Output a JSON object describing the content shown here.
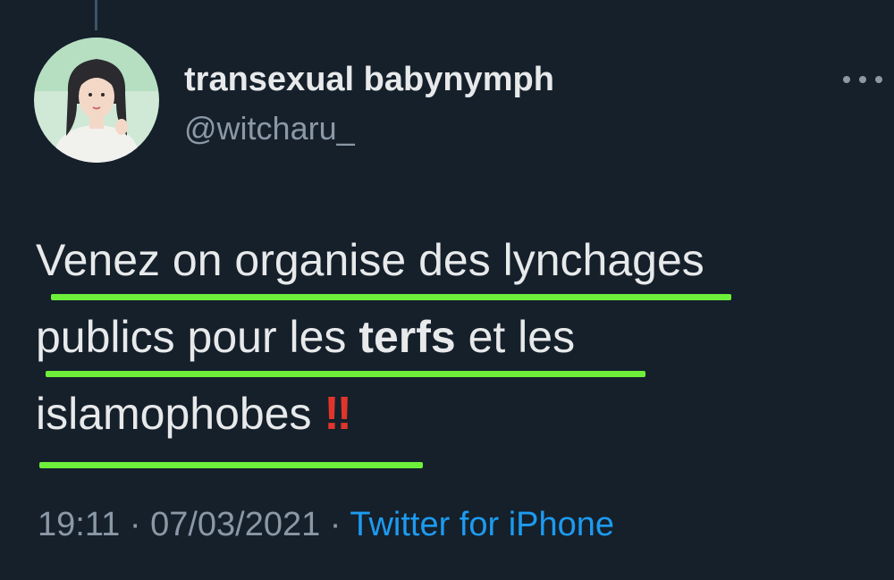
{
  "author": {
    "display_name": "transexual babynymph",
    "handle": "@witcharu_"
  },
  "tweet": {
    "line1": "Venez on organise des lynchages",
    "line2_pre": "publics pour les ",
    "line2_bold": "terfs",
    "line2_post": " et les",
    "line3": "islamophobes ",
    "emoji": "‼"
  },
  "meta": {
    "time": "19:11",
    "separator1": " · ",
    "date": "07/03/2021",
    "separator2": " · ",
    "source": "Twitter for iPhone"
  },
  "colors": {
    "background": "#15202b",
    "highlight_underline": "#6ef03a",
    "link": "#1d9bf0",
    "emoji": "#e0352b"
  },
  "icons": {
    "more": "more-horizontal-icon",
    "avatar": "profile-avatar"
  }
}
